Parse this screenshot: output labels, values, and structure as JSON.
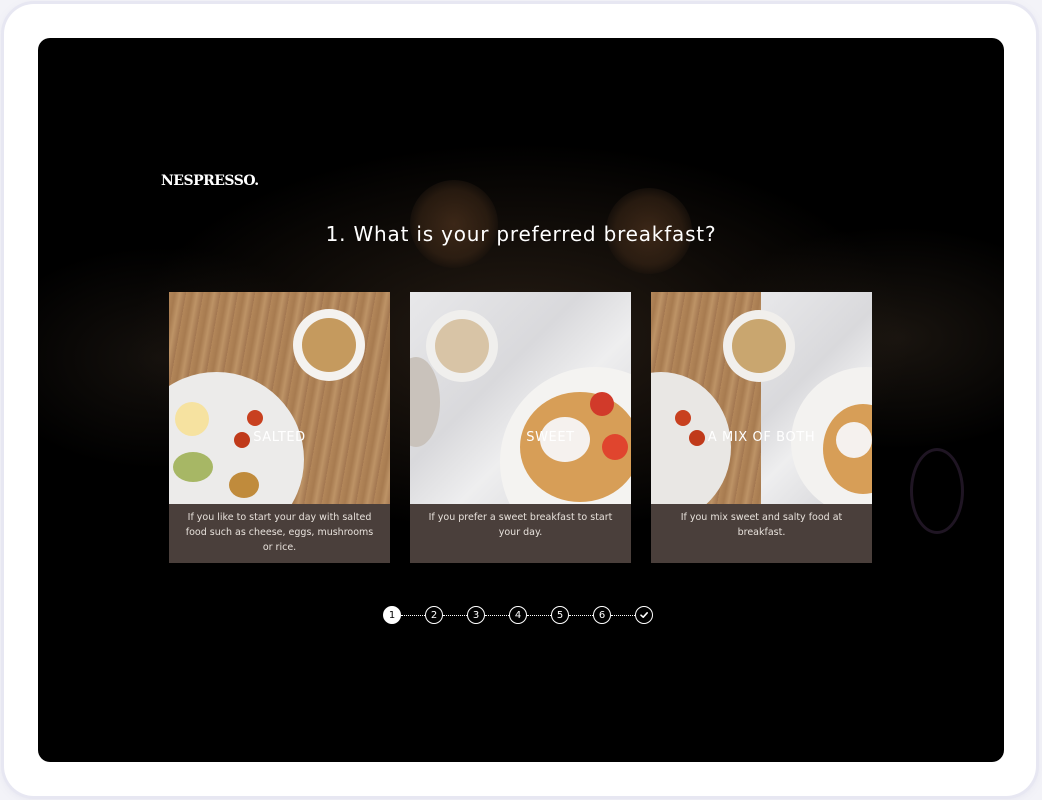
{
  "brand": {
    "logo_text": "NESPRESSO."
  },
  "question": {
    "title": "1. What is your preferred breakfast?"
  },
  "options": [
    {
      "title": "SALTED",
      "description": "If you like to start your day with salted food such as cheese, eggs, mushrooms or rice."
    },
    {
      "title": "SWEET",
      "description": "If you prefer a sweet breakfast to start your day."
    },
    {
      "title": "A MIX OF BOTH",
      "description": "If you mix sweet and salty food at breakfast."
    }
  ],
  "stepper": {
    "steps": [
      "1",
      "2",
      "3",
      "4",
      "5",
      "6"
    ],
    "final_icon": "check-icon",
    "current_step": 1
  },
  "colors": {
    "background": "#000000",
    "card_caption": "#4a3f3b",
    "text": "#ffffff",
    "frame": "#ffffff"
  }
}
